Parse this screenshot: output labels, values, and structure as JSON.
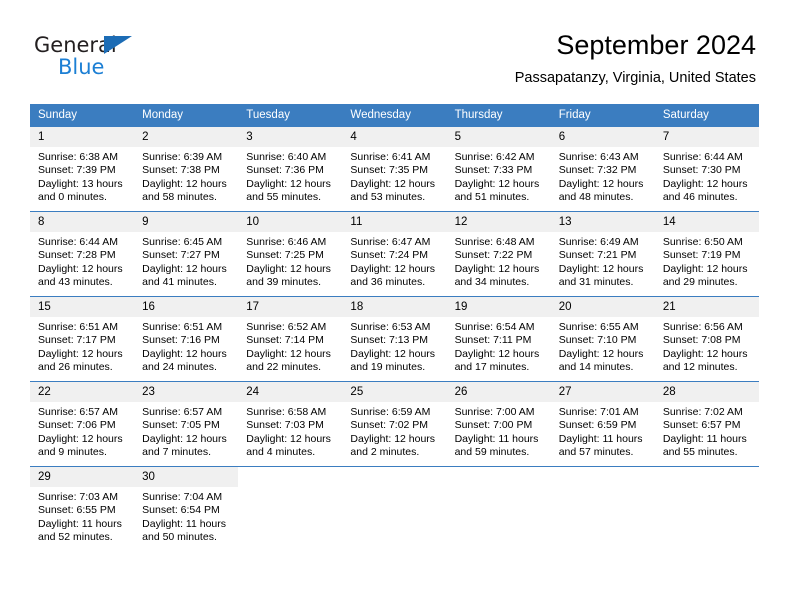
{
  "brand": {
    "name_part1": "General",
    "name_part2": "Blue",
    "logo_icon": "triangle-icon"
  },
  "header": {
    "title": "September 2024",
    "subtitle": "Passapatanzy, Virginia, United States"
  },
  "colors": {
    "header_blue": "#3b7dc0",
    "brand_blue": "#1c7fd4",
    "daynum_band": "#f0f0f0",
    "text": "#000000"
  },
  "calendar": {
    "weekday_headers": [
      "Sunday",
      "Monday",
      "Tuesday",
      "Wednesday",
      "Thursday",
      "Friday",
      "Saturday"
    ],
    "weeks": [
      [
        {
          "day": "1",
          "sunrise": "Sunrise: 6:38 AM",
          "sunset": "Sunset: 7:39 PM",
          "daylight_l1": "Daylight: 13 hours",
          "daylight_l2": "and 0 minutes."
        },
        {
          "day": "2",
          "sunrise": "Sunrise: 6:39 AM",
          "sunset": "Sunset: 7:38 PM",
          "daylight_l1": "Daylight: 12 hours",
          "daylight_l2": "and 58 minutes."
        },
        {
          "day": "3",
          "sunrise": "Sunrise: 6:40 AM",
          "sunset": "Sunset: 7:36 PM",
          "daylight_l1": "Daylight: 12 hours",
          "daylight_l2": "and 55 minutes."
        },
        {
          "day": "4",
          "sunrise": "Sunrise: 6:41 AM",
          "sunset": "Sunset: 7:35 PM",
          "daylight_l1": "Daylight: 12 hours",
          "daylight_l2": "and 53 minutes."
        },
        {
          "day": "5",
          "sunrise": "Sunrise: 6:42 AM",
          "sunset": "Sunset: 7:33 PM",
          "daylight_l1": "Daylight: 12 hours",
          "daylight_l2": "and 51 minutes."
        },
        {
          "day": "6",
          "sunrise": "Sunrise: 6:43 AM",
          "sunset": "Sunset: 7:32 PM",
          "daylight_l1": "Daylight: 12 hours",
          "daylight_l2": "and 48 minutes."
        },
        {
          "day": "7",
          "sunrise": "Sunrise: 6:44 AM",
          "sunset": "Sunset: 7:30 PM",
          "daylight_l1": "Daylight: 12 hours",
          "daylight_l2": "and 46 minutes."
        }
      ],
      [
        {
          "day": "8",
          "sunrise": "Sunrise: 6:44 AM",
          "sunset": "Sunset: 7:28 PM",
          "daylight_l1": "Daylight: 12 hours",
          "daylight_l2": "and 43 minutes."
        },
        {
          "day": "9",
          "sunrise": "Sunrise: 6:45 AM",
          "sunset": "Sunset: 7:27 PM",
          "daylight_l1": "Daylight: 12 hours",
          "daylight_l2": "and 41 minutes."
        },
        {
          "day": "10",
          "sunrise": "Sunrise: 6:46 AM",
          "sunset": "Sunset: 7:25 PM",
          "daylight_l1": "Daylight: 12 hours",
          "daylight_l2": "and 39 minutes."
        },
        {
          "day": "11",
          "sunrise": "Sunrise: 6:47 AM",
          "sunset": "Sunset: 7:24 PM",
          "daylight_l1": "Daylight: 12 hours",
          "daylight_l2": "and 36 minutes."
        },
        {
          "day": "12",
          "sunrise": "Sunrise: 6:48 AM",
          "sunset": "Sunset: 7:22 PM",
          "daylight_l1": "Daylight: 12 hours",
          "daylight_l2": "and 34 minutes."
        },
        {
          "day": "13",
          "sunrise": "Sunrise: 6:49 AM",
          "sunset": "Sunset: 7:21 PM",
          "daylight_l1": "Daylight: 12 hours",
          "daylight_l2": "and 31 minutes."
        },
        {
          "day": "14",
          "sunrise": "Sunrise: 6:50 AM",
          "sunset": "Sunset: 7:19 PM",
          "daylight_l1": "Daylight: 12 hours",
          "daylight_l2": "and 29 minutes."
        }
      ],
      [
        {
          "day": "15",
          "sunrise": "Sunrise: 6:51 AM",
          "sunset": "Sunset: 7:17 PM",
          "daylight_l1": "Daylight: 12 hours",
          "daylight_l2": "and 26 minutes."
        },
        {
          "day": "16",
          "sunrise": "Sunrise: 6:51 AM",
          "sunset": "Sunset: 7:16 PM",
          "daylight_l1": "Daylight: 12 hours",
          "daylight_l2": "and 24 minutes."
        },
        {
          "day": "17",
          "sunrise": "Sunrise: 6:52 AM",
          "sunset": "Sunset: 7:14 PM",
          "daylight_l1": "Daylight: 12 hours",
          "daylight_l2": "and 22 minutes."
        },
        {
          "day": "18",
          "sunrise": "Sunrise: 6:53 AM",
          "sunset": "Sunset: 7:13 PM",
          "daylight_l1": "Daylight: 12 hours",
          "daylight_l2": "and 19 minutes."
        },
        {
          "day": "19",
          "sunrise": "Sunrise: 6:54 AM",
          "sunset": "Sunset: 7:11 PM",
          "daylight_l1": "Daylight: 12 hours",
          "daylight_l2": "and 17 minutes."
        },
        {
          "day": "20",
          "sunrise": "Sunrise: 6:55 AM",
          "sunset": "Sunset: 7:10 PM",
          "daylight_l1": "Daylight: 12 hours",
          "daylight_l2": "and 14 minutes."
        },
        {
          "day": "21",
          "sunrise": "Sunrise: 6:56 AM",
          "sunset": "Sunset: 7:08 PM",
          "daylight_l1": "Daylight: 12 hours",
          "daylight_l2": "and 12 minutes."
        }
      ],
      [
        {
          "day": "22",
          "sunrise": "Sunrise: 6:57 AM",
          "sunset": "Sunset: 7:06 PM",
          "daylight_l1": "Daylight: 12 hours",
          "daylight_l2": "and 9 minutes."
        },
        {
          "day": "23",
          "sunrise": "Sunrise: 6:57 AM",
          "sunset": "Sunset: 7:05 PM",
          "daylight_l1": "Daylight: 12 hours",
          "daylight_l2": "and 7 minutes."
        },
        {
          "day": "24",
          "sunrise": "Sunrise: 6:58 AM",
          "sunset": "Sunset: 7:03 PM",
          "daylight_l1": "Daylight: 12 hours",
          "daylight_l2": "and 4 minutes."
        },
        {
          "day": "25",
          "sunrise": "Sunrise: 6:59 AM",
          "sunset": "Sunset: 7:02 PM",
          "daylight_l1": "Daylight: 12 hours",
          "daylight_l2": "and 2 minutes."
        },
        {
          "day": "26",
          "sunrise": "Sunrise: 7:00 AM",
          "sunset": "Sunset: 7:00 PM",
          "daylight_l1": "Daylight: 11 hours",
          "daylight_l2": "and 59 minutes."
        },
        {
          "day": "27",
          "sunrise": "Sunrise: 7:01 AM",
          "sunset": "Sunset: 6:59 PM",
          "daylight_l1": "Daylight: 11 hours",
          "daylight_l2": "and 57 minutes."
        },
        {
          "day": "28",
          "sunrise": "Sunrise: 7:02 AM",
          "sunset": "Sunset: 6:57 PM",
          "daylight_l1": "Daylight: 11 hours",
          "daylight_l2": "and 55 minutes."
        }
      ],
      [
        {
          "day": "29",
          "sunrise": "Sunrise: 7:03 AM",
          "sunset": "Sunset: 6:55 PM",
          "daylight_l1": "Daylight: 11 hours",
          "daylight_l2": "and 52 minutes."
        },
        {
          "day": "30",
          "sunrise": "Sunrise: 7:04 AM",
          "sunset": "Sunset: 6:54 PM",
          "daylight_l1": "Daylight: 11 hours",
          "daylight_l2": "and 50 minutes."
        },
        {
          "day": "",
          "sunrise": "",
          "sunset": "",
          "daylight_l1": "",
          "daylight_l2": ""
        },
        {
          "day": "",
          "sunrise": "",
          "sunset": "",
          "daylight_l1": "",
          "daylight_l2": ""
        },
        {
          "day": "",
          "sunrise": "",
          "sunset": "",
          "daylight_l1": "",
          "daylight_l2": ""
        },
        {
          "day": "",
          "sunrise": "",
          "sunset": "",
          "daylight_l1": "",
          "daylight_l2": ""
        },
        {
          "day": "",
          "sunrise": "",
          "sunset": "",
          "daylight_l1": "",
          "daylight_l2": ""
        }
      ]
    ]
  }
}
